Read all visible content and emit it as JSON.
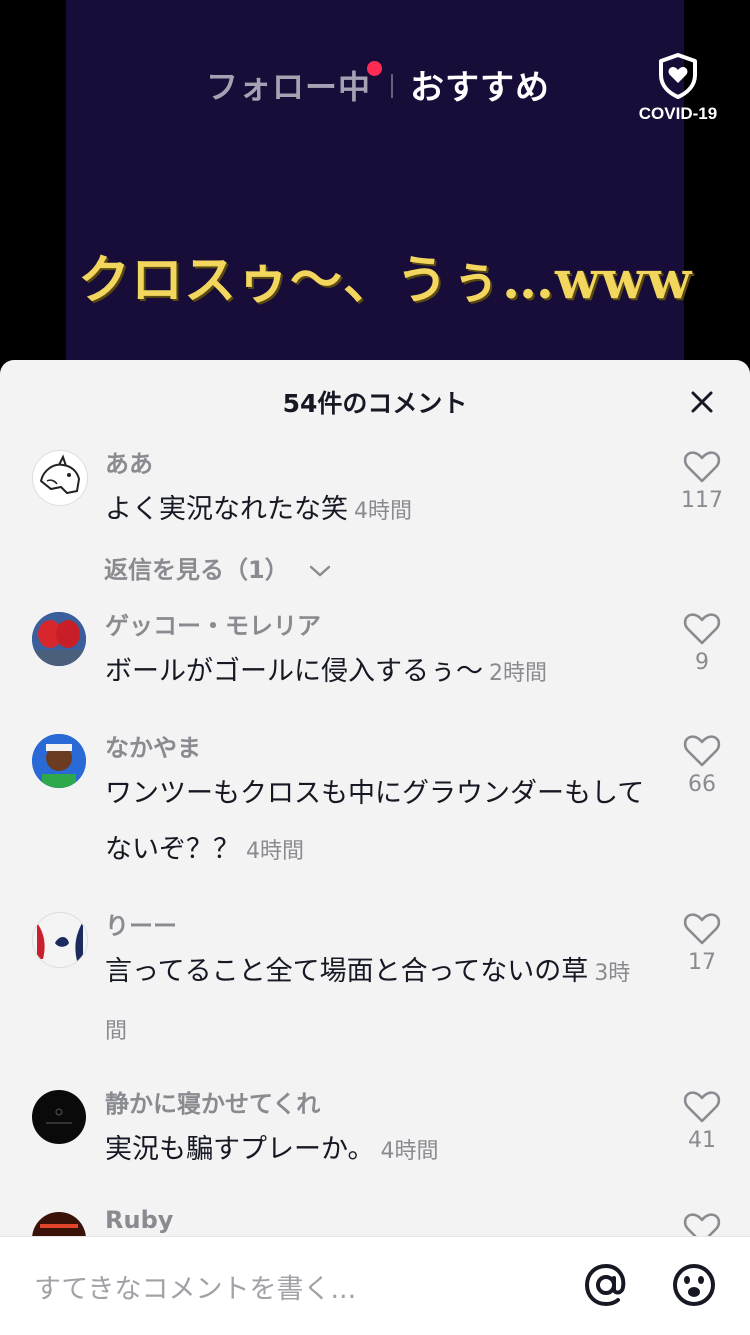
{
  "nav": {
    "following": "フォロー中",
    "recommended": "おすすめ",
    "covid": "COVID-19"
  },
  "video": {
    "caption": "クロスゥ〜、うぅ…www"
  },
  "sheet": {
    "title": "54件のコメント",
    "comments": [
      {
        "user": "ああ",
        "text": "よく実況なれたな笑",
        "time": "4時間",
        "likes": "117",
        "replies": "返信を見る（1）"
      },
      {
        "user": "ゲッコー・モレリア",
        "text": "ボールがゴールに侵入するぅ〜",
        "time": "2時間",
        "likes": "9"
      },
      {
        "user": "なかやま",
        "text": "ワンツーもクロスも中にグラウンダーもしてないぞ？？",
        "time": "4時間",
        "likes": "66"
      },
      {
        "user": "りーー",
        "text": "言ってること全て場面と合ってないの草",
        "time": "3時間",
        "likes": "17"
      },
      {
        "user": "静かに寝かせてくれ",
        "text": "実況も騙すプレーか。",
        "time": "4時間",
        "likes": "41"
      },
      {
        "user": "Ruby"
      }
    ]
  },
  "input": {
    "placeholder": "すてきなコメントを書く..."
  },
  "colors": {
    "accent": "#fe2c55",
    "caption": "#f3d65e",
    "video_bg": "#170d38"
  }
}
